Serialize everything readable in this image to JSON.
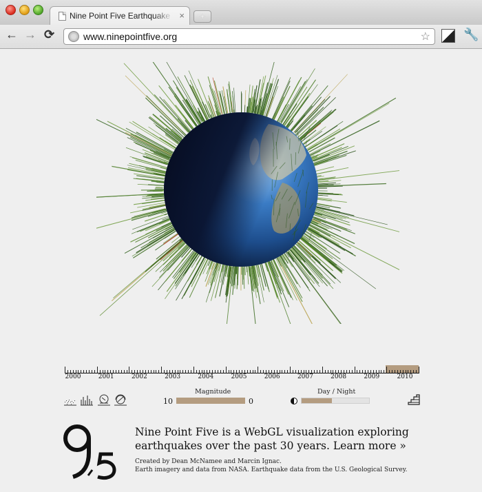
{
  "browser": {
    "tab_title": "Nine Point Five Earthquake Visualization",
    "tab_close": "×",
    "new_tab": "+",
    "url": "www.ninepointfive.org",
    "star": "☆",
    "back": "←",
    "forward": "→",
    "reload": "⟳",
    "wrench": "🔧"
  },
  "timeline": {
    "years": [
      "2000",
      "2001",
      "2002",
      "2003",
      "2004",
      "2005",
      "2006",
      "2007",
      "2008",
      "2009",
      "2010"
    ],
    "selected_year": "2010"
  },
  "controls": {
    "view_icons": [
      "scatter-view-icon",
      "histogram-view-icon",
      "globe-view-icon",
      "globe-rotate-icon"
    ],
    "magnitude_label": "Magnitude",
    "magnitude_min": "10",
    "magnitude_max": "0",
    "daynight_label": "Day / Night",
    "daynight_level": 0.45
  },
  "footer": {
    "logo_text": "9,5",
    "description": "Nine Point Five is a WebGL visualization exploring earthquakes over the past 30 years.",
    "learn_more": "Learn more »",
    "credit_1": "Created by Dean McNamee and Marcin Ignac.",
    "credit_2": "Earth imagery and data from NASA. Earthquake data from the U.S. Geological Survey."
  },
  "colors": {
    "accent": "#b49c80",
    "spike": "#3a6a1f",
    "ocean": "#2f6fb8"
  }
}
